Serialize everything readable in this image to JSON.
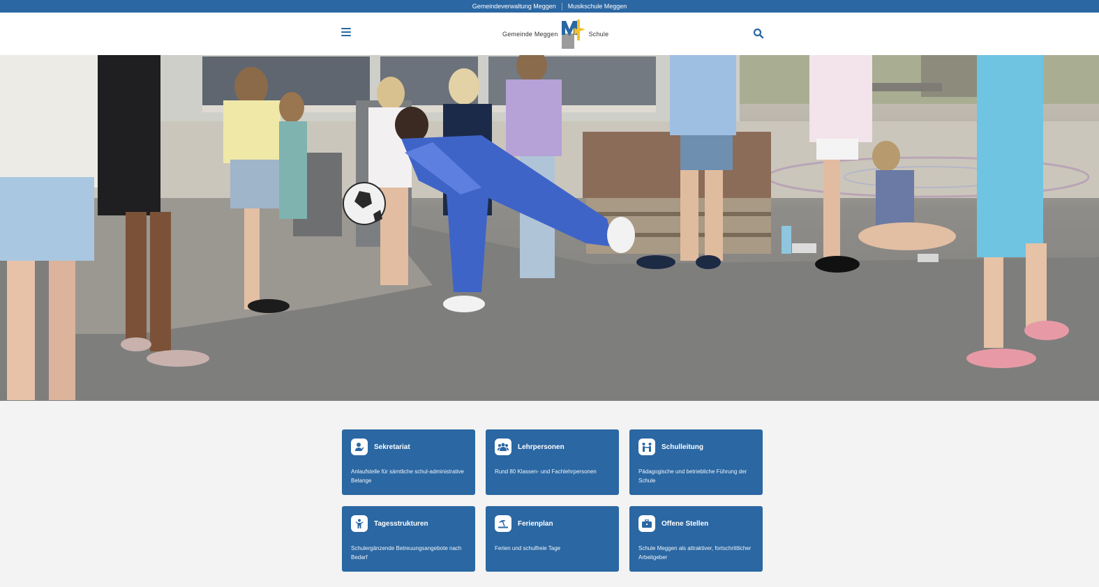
{
  "topbar": {
    "links": [
      "Gemeindeverwaltung Meggen",
      "Musikschule Meggen"
    ]
  },
  "header": {
    "logo_left": "Gemeinde Meggen",
    "logo_right": "Schule",
    "menu_icon": "hamburger-icon",
    "search_icon": "search-icon"
  },
  "carousel": {
    "slide_count": 6,
    "active_index": 4
  },
  "cards": [
    {
      "title": "Sekretariat",
      "desc": "Anlaufstelle für sämtliche schul-administrative Belange",
      "icon": "secretary-icon"
    },
    {
      "title": "Lehrpersonen",
      "desc": "Rund 80 Klassen- und Fachlehrpersonen",
      "icon": "group-icon"
    },
    {
      "title": "Schulleitung",
      "desc": "Pädagogische und betriebliche Führung der Schule",
      "icon": "leadership-icon"
    },
    {
      "title": "Tagesstrukturen",
      "desc": "Schulergänzende Betreuungsangebote nach Bedarf",
      "icon": "child-icon"
    },
    {
      "title": "Ferienplan",
      "desc": "Ferien und schulfreie Tage",
      "icon": "beach-umbrella-icon"
    },
    {
      "title": "Offene Stellen",
      "desc": "Schule Meggen als attraktiver, fortschrittlicher Arbeitgeber",
      "icon": "briefcase-icon"
    }
  ],
  "colors": {
    "brand_blue": "#2a67a3",
    "background": "#f3f3f3",
    "logo_yellow": "#f2c12e"
  }
}
